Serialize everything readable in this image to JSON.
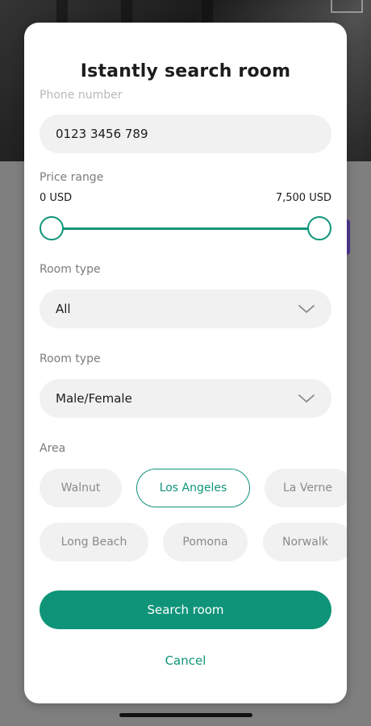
{
  "modal": {
    "title": "Istantly search room",
    "phone": {
      "label": "Phone number",
      "value": "0123 3456 789"
    },
    "price": {
      "label": "Price range",
      "min_label": "0 USD",
      "max_label": "7,500 USD",
      "min_fraction": 0,
      "max_fraction": 1
    },
    "room_type_1": {
      "label": "Room type",
      "value": "All"
    },
    "room_type_2": {
      "label": "Room type",
      "value": "Male/Female"
    },
    "area": {
      "label": "Area",
      "chips": [
        {
          "label": "Walnut",
          "selected": false
        },
        {
          "label": "Los Angeles",
          "selected": true
        },
        {
          "label": "La Verne",
          "selected": false
        },
        {
          "label": "Long Beach",
          "selected": false
        },
        {
          "label": "Pomona",
          "selected": false
        },
        {
          "label": "Norwalk",
          "selected": false
        }
      ]
    },
    "search_button": "Search room",
    "cancel_button": "Cancel"
  },
  "colors": {
    "accent": "#0f9479",
    "pill_bg": "#f1f1f1",
    "text": "#1c1c1c",
    "muted": "#7c7c7c"
  },
  "icons": {
    "select_chevron": "chevron-down-icon"
  }
}
